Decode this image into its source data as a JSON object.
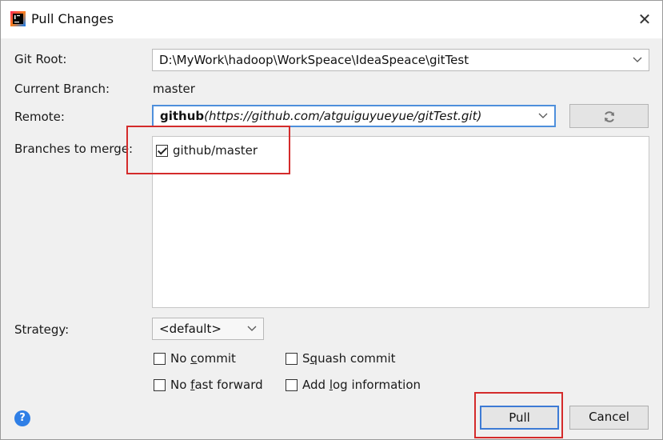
{
  "window": {
    "title": "Pull Changes",
    "close_glyph": "✕"
  },
  "labels": {
    "git_root": "Git Root:",
    "current_branch": "Current Branch:",
    "remote": "Remote:",
    "branches_to_merge": "Branches to merge:",
    "strategy": "Strategy:"
  },
  "git_root": {
    "value": "D:\\MyWork\\hadoop\\WorkSpeace\\IdeaSpeace\\gitTest"
  },
  "current_branch": {
    "value": "master"
  },
  "remote": {
    "name": "github",
    "open_paren": "(",
    "url": "https://github.com/atguiguyueyue/gitTest.git",
    "close_paren": ")"
  },
  "branches": [
    {
      "label": "github/master",
      "checked": true
    }
  ],
  "strategy": {
    "value": "<default>"
  },
  "options": {
    "no_commit": {
      "pre": "No ",
      "mnemonic": "c",
      "post": "ommit"
    },
    "squash_commit": {
      "pre": "S",
      "mnemonic": "q",
      "post": "uash commit"
    },
    "no_fast_forward": {
      "pre": "No ",
      "mnemonic": "f",
      "post": "ast forward"
    },
    "add_log": {
      "pre": "Add ",
      "mnemonic": "l",
      "post": "og information"
    }
  },
  "buttons": {
    "pull": "Pull",
    "cancel": "Cancel",
    "help": "?"
  },
  "icons": {
    "app": "intellij-idea-icon",
    "refresh": "refresh-icon",
    "chevron": "chevron-down-icon"
  },
  "colors": {
    "highlight": "#d42b2b",
    "focus": "#4e8fdc",
    "help": "#2f7fe6"
  }
}
